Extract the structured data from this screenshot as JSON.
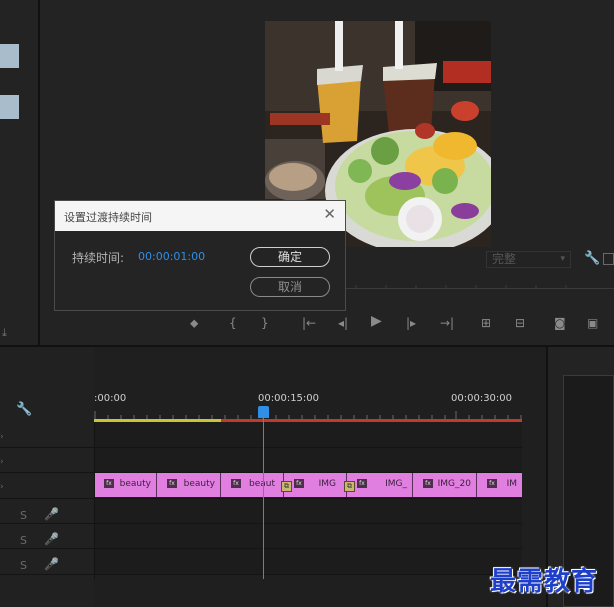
{
  "dialog": {
    "title": "设置过渡持续时间",
    "duration_label": "持续时间:",
    "duration_value": "00:00:01:00",
    "ok_label": "确定",
    "cancel_label": "取消",
    "close_icon": "close-icon"
  },
  "monitor": {
    "quality_value": "完整"
  },
  "timeline": {
    "time_labels": [
      ":00:00",
      "00:00:15:00",
      "00:00:30:00"
    ],
    "clips": [
      "beauty",
      "beauty",
      "beaut",
      "IMG",
      "IMG_",
      "IMG_20",
      "IM"
    ],
    "audio_tracks": [
      "S",
      "S",
      "S"
    ]
  },
  "colors": {
    "accent": "#2f8ee6",
    "clip": "#e07fe0",
    "work_area_yellow": "#c9c335",
    "work_area_red": "#c23a2d"
  },
  "watermark": "最需教育"
}
